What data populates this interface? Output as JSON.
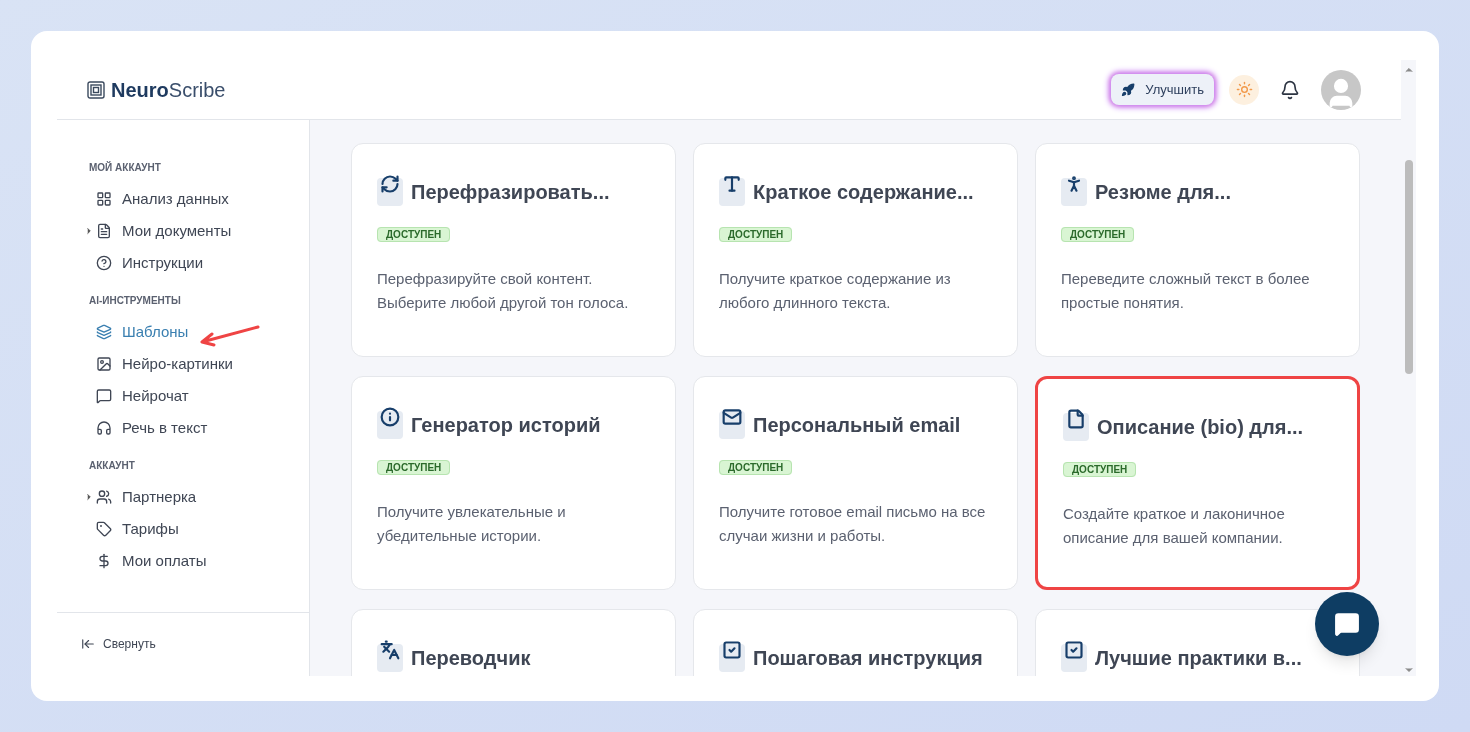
{
  "logo": {
    "bold": "Neuro",
    "light": "Scribe"
  },
  "header": {
    "upgrade_button": "Улучшить"
  },
  "sidebar": {
    "sections": [
      {
        "title": "МОЙ АККАУНТ",
        "items": [
          {
            "label": "Анализ данных",
            "expandable": false,
            "selected": false
          },
          {
            "label": "Мои документы",
            "expandable": true,
            "selected": false
          },
          {
            "label": "Инструкции",
            "expandable": false,
            "selected": false
          }
        ]
      },
      {
        "title": "AI-ИНСТРУМЕНТЫ",
        "items": [
          {
            "label": "Шаблоны",
            "expandable": false,
            "selected": true
          },
          {
            "label": "Нейро-картинки",
            "expandable": false,
            "selected": false
          },
          {
            "label": "Нейрочат",
            "expandable": false,
            "selected": false
          },
          {
            "label": "Речь в текст",
            "expandable": false,
            "selected": false
          }
        ]
      },
      {
        "title": "АККАУНТ",
        "items": [
          {
            "label": "Партнерка",
            "expandable": true,
            "selected": false
          },
          {
            "label": "Тарифы",
            "expandable": false,
            "selected": false
          },
          {
            "label": "Мои оплаты",
            "expandable": false,
            "selected": false
          }
        ]
      }
    ],
    "collapse": "Свернуть"
  },
  "templates": [
    {
      "title": "Перефразировать...",
      "badge": "ДОСТУПЕН",
      "description": "Перефразируйте свой контент. Выберите любой другой тон голоса.",
      "highlighted": false
    },
    {
      "title": "Краткое содержание...",
      "badge": "ДОСТУПЕН",
      "description": "Получите краткое содержание из любого длинного текста.",
      "highlighted": false
    },
    {
      "title": "Резюме для...",
      "badge": "ДОСТУПЕН",
      "description": "Переведите сложный текст в более простые понятия.",
      "highlighted": false
    },
    {
      "title": "Генератор историй",
      "badge": "ДОСТУПЕН",
      "description": "Получите увлекательные и убедительные истории.",
      "highlighted": false
    },
    {
      "title": "Персональный email",
      "badge": "ДОСТУПЕН",
      "description": "Получите готовое email письмо на все случаи жизни и работы.",
      "highlighted": false
    },
    {
      "title": "Описание (bio) для...",
      "badge": "ДОСТУПЕН",
      "description": "Создайте краткое и лаконичное описание для вашей компании.",
      "highlighted": true
    },
    {
      "title": "Переводчик",
      "highlighted": false
    },
    {
      "title": "Пошаговая инструкция",
      "highlighted": false
    },
    {
      "title": "Лучшие практики в...",
      "highlighted": false
    }
  ]
}
